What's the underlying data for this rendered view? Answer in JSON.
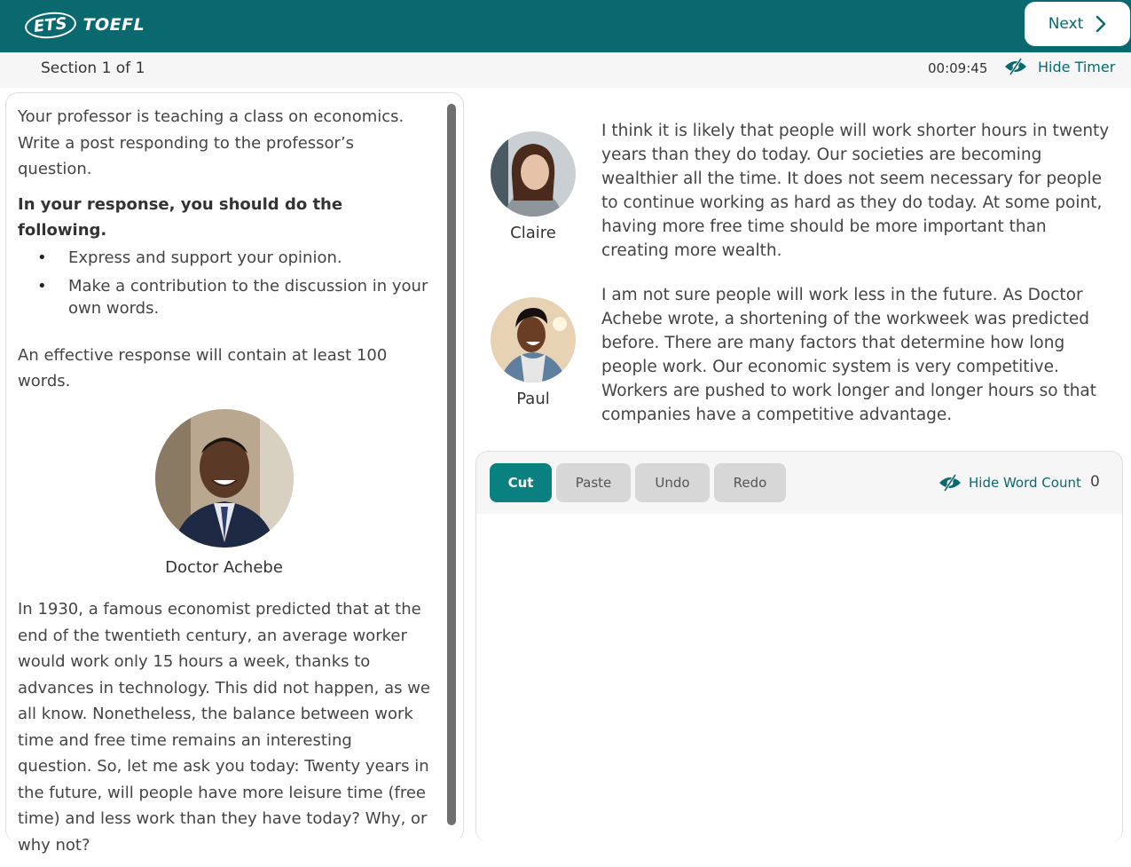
{
  "header": {
    "logo_ets": "ETS",
    "logo_toefl": "TOEFL",
    "next_label": "Next"
  },
  "subbar": {
    "section": "Section 1 of 1",
    "timer": "00:09:45",
    "hide_timer_label": "Hide Timer"
  },
  "prompt": {
    "intro": "Your professor is teaching a class on economics. Write a post responding to the professor’s question.",
    "instructions_heading": "In your response, you should do the following.",
    "bullets": [
      "Express and support your opinion.",
      "Make a contribution to the discussion in your own words."
    ],
    "length_note": "An effective response will contain at least 100 words.",
    "professor_name": "Doctor Achebe",
    "professor_question": "In 1930, a famous economist predicted that at the end of the twentieth century, an average worker would work only 15 hours a week, thanks to advances in technology. This did not happen, as we all know. Nonetheless, the balance between work time and free time remains an interesting question. So, let me ask you today: Twenty years in the future, will people have more leisure time (free time) and less work than they have today? Why, or why not?"
  },
  "posts": [
    {
      "name": "Claire",
      "text": "I think it is likely that people will work shorter hours in twenty years than they do today. Our societies are becoming wealthier all the time. It does not seem necessary for people to continue working as hard as they do today. At some point, having more free time should be more important than creating more wealth."
    },
    {
      "name": "Paul",
      "text": "I am not sure people will work less in the future. As Doctor Achebe wrote, a shortening of the workweek was predicted before. There are many factors that determine how long people work. Our economic system is very competitive. Workers are pushed to work longer and longer hours so that companies have a competitive advantage."
    }
  ],
  "editor": {
    "cut_label": "Cut",
    "paste_label": "Paste",
    "undo_label": "Undo",
    "redo_label": "Redo",
    "hide_word_count_label": "Hide Word Count",
    "word_count": "0",
    "response_value": ""
  },
  "colors": {
    "brand": "#0a696e",
    "accent_button": "#0b8080"
  }
}
